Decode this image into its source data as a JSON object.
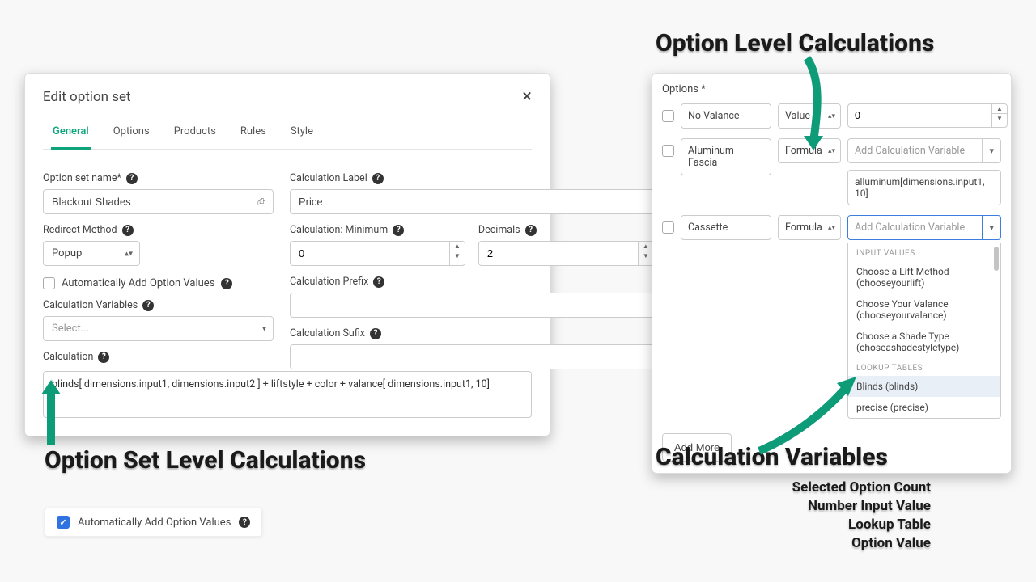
{
  "modal": {
    "title": "Edit option set",
    "tabs": [
      "General",
      "Options",
      "Products",
      "Rules",
      "Style"
    ],
    "active_tab": 0,
    "left": {
      "option_set_name_label": "Option set name*",
      "option_set_name_value": "Blackout Shades",
      "redirect_method_label": "Redirect Method",
      "redirect_method_value": "Popup",
      "auto_add_label": "Automatically Add Option Values",
      "calc_vars_label": "Calculation Variables",
      "calc_vars_placeholder": "Select...",
      "calc_label": "Calculation",
      "calc_value": "blinds[ dimensions.input1, dimensions.input2 ]  +  liftstyle + color +  valance[  dimensions.input1, 10]"
    },
    "right": {
      "calc_label_label": "Calculation Label",
      "calc_label_value": "Price",
      "calc_min_label": "Calculation: Minimum",
      "calc_min_value": "0",
      "decimals_label": "Decimals",
      "decimals_value": "2",
      "calc_prefix_label": "Calculation Prefix",
      "calc_prefix_value": "",
      "calc_suffix_label": "Calculation Sufix",
      "calc_suffix_value": ""
    }
  },
  "options_panel": {
    "title": "Options *",
    "rows": [
      {
        "name": "No Valance",
        "type": "Value",
        "num": "0"
      },
      {
        "name": "Aluminum Fascia",
        "type": "Formula",
        "placeholder": "Add Calculation Variable",
        "formula": "alluminum[dimensions.input1, 10]"
      },
      {
        "name": "Cassette",
        "type": "Formula",
        "placeholder": "Add Calculation Variable"
      }
    ],
    "dropdown": {
      "group1": "INPUT VALUES",
      "items1": [
        "Choose a Lift Method (chooseyourlift)",
        "Choose Your Valance (chooseyourvalance)",
        "Choose a Shade Type (choseashadestyletype)"
      ],
      "group2": "LOOKUP TABLES",
      "items2": [
        "Blinds (blinds)",
        "precise (precise)"
      ],
      "highlight_index": 0
    },
    "add_more": "Add More"
  },
  "solo_checkbox": {
    "label": "Automatically Add Option Values"
  },
  "annotations": {
    "top_right": "Option Level Calculations",
    "bottom_left": "Option Set Level Calculations",
    "bottom_right_title": "Calculation Variables",
    "bottom_right_lines": [
      "Selected Option Count",
      "Number Input Value",
      "Lookup Table",
      "Option Value"
    ]
  }
}
